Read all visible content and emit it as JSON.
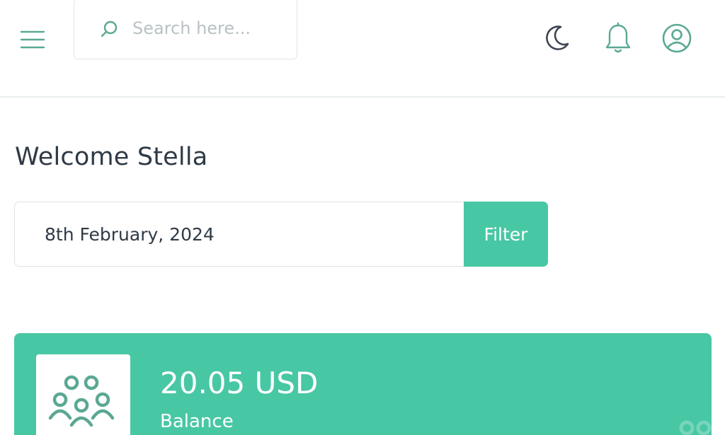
{
  "header": {
    "search_placeholder": "Search here...",
    "icons": {
      "menu": "hamburger-menu-icon",
      "search": "search-icon",
      "theme": "moon-icon",
      "notifications": "bell-icon",
      "profile": "user-circle-icon"
    }
  },
  "welcome": {
    "text": "Welcome Stella"
  },
  "filter": {
    "date_value": "8th February, 2024",
    "button_label": "Filter"
  },
  "balance_card": {
    "amount": "20.05 USD",
    "label": "Balance",
    "icon": "people-group-icon"
  },
  "colors": {
    "accent": "#48c7a5",
    "icon_teal": "#5aa894",
    "text_dark": "#2f3a46",
    "border": "#dde3e6"
  }
}
